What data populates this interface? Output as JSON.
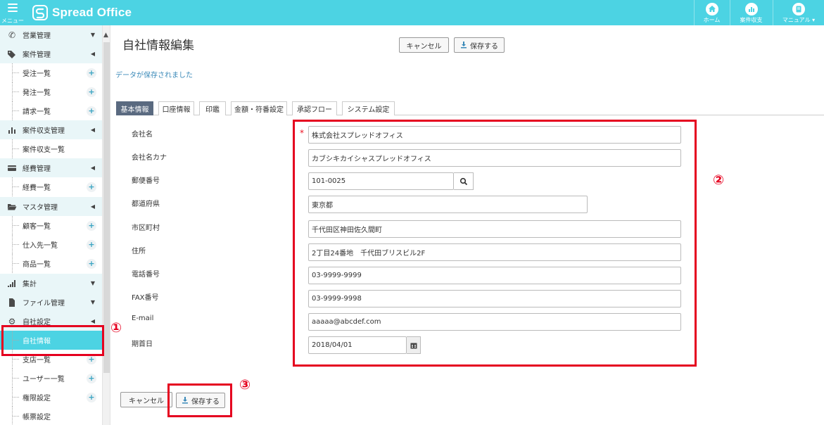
{
  "topbar": {
    "menu_label": "メニュー",
    "logo_text": "Spread Office",
    "home_label": "ホーム",
    "project_label": "案件収支",
    "manual_label": "マニュアル ▾"
  },
  "sidebar": {
    "sections": [
      {
        "label": "営業管理",
        "icon": "phone-icon",
        "arrow": "▼"
      },
      {
        "label": "案件管理",
        "icon": "tags-icon",
        "arrow": "◀"
      },
      {
        "label": "受注一覧"
      },
      {
        "label": "発注一覧"
      },
      {
        "label": "請求一覧"
      },
      {
        "label": "案件収支管理",
        "icon": "bar-chart-icon",
        "arrow": "◀"
      },
      {
        "label": "案件収支一覧"
      },
      {
        "label": "経費管理",
        "icon": "credit-card-icon",
        "arrow": "◀"
      },
      {
        "label": "経費一覧"
      },
      {
        "label": "マスタ管理",
        "icon": "folder-open-icon",
        "arrow": "◀"
      },
      {
        "label": "顧客一覧"
      },
      {
        "label": "仕入先一覧"
      },
      {
        "label": "商品一覧"
      },
      {
        "label": "集計",
        "icon": "signal-icon",
        "arrow": "▼"
      },
      {
        "label": "ファイル管理",
        "icon": "file-icon",
        "arrow": "▼"
      },
      {
        "label": "自社設定",
        "icon": "gear-icon",
        "arrow": "◀"
      },
      {
        "label": "自社情報"
      },
      {
        "label": "支店一覧"
      },
      {
        "label": "ユーザー一覧"
      },
      {
        "label": "権限設定"
      },
      {
        "label": "帳票設定"
      }
    ]
  },
  "page": {
    "title": "自社情報編集",
    "cancel_label": "キャンセル",
    "save_label": "保存する",
    "saved_message": "データが保存されました"
  },
  "tabs": [
    "基本情報",
    "口座情報",
    "印鑑",
    "金額・符番設定",
    "承認フロー",
    "システム設定"
  ],
  "form": {
    "required_mark": "*",
    "fields": [
      {
        "label": "会社名",
        "value": "株式会社スプレッドオフィス"
      },
      {
        "label": "会社名カナ",
        "value": "カブシキカイシャスプレッドオフィス"
      },
      {
        "label": "郵便番号",
        "value": "101-0025"
      },
      {
        "label": "都道府県",
        "value": "東京都"
      },
      {
        "label": "市区町村",
        "value": "千代田区神田佐久間町"
      },
      {
        "label": "住所",
        "value": "2丁目24番地　千代田ブリスビル2F"
      },
      {
        "label": "電話番号",
        "value": "03-9999-9999"
      },
      {
        "label": "FAX番号",
        "value": "03-9999-9998"
      },
      {
        "label": "E-mail",
        "value": "aaaaa@abcdef.com"
      },
      {
        "label": "期首日",
        "value": "2018/04/01"
      }
    ]
  },
  "annotations": {
    "one": "①",
    "two": "②",
    "three": "③",
    "color": "#e5001f"
  },
  "colors": {
    "accent": "#4cd3e3",
    "active_tab": "#5a6a80",
    "link": "#3a89b8"
  }
}
